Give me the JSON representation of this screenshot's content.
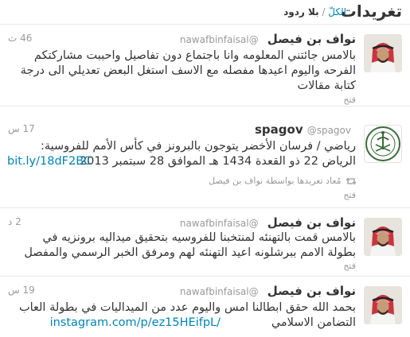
{
  "header": {
    "title": "تغريدات",
    "filter_all": "الكلّ",
    "filter_separator": "/",
    "filter_no_replies": "بلا ردود"
  },
  "tweets": [
    {
      "fullname": "نواف بن فيصل",
      "screenname": "@nawafbinfaisal",
      "time": "46 ث",
      "lines": [
        "بالامس جائتني المعلومه وانا باجتماع دون تفاصيل واحببت مشاركتكم",
        "الفرحه واليوم اعيدها مفصله مع الاسف استغل البعض تعديلي الى درجة",
        "كتابة مقالات"
      ],
      "action": "فتح"
    },
    {
      "fullname": "spagov",
      "screenname": "@spagov",
      "time": "17 س",
      "lines": [
        "رياضي / فرسان الأخضر يتوجون بالبرونز في كأس الأمم للفروسية:",
        "الرياض 22 ذو القعدة 1434 هـ الموافق 28 سبتمبر 2013..."
      ],
      "link": "bit.ly/18dF2BC",
      "retweeted_by": "مُعاد تغريدها بواسطة نواف بن فيصل",
      "action": "فتح"
    },
    {
      "fullname": "نواف بن فيصل",
      "screenname": "@nawafbinfaisal",
      "time": "2 د",
      "lines": [
        "بالامس قمت بالتهنئه لمنتخبنا للفروسيه بتحقيق ميداليه برونزيه في",
        "بطولة الامم ببرشلونه اعيد التهنئه لهم ومرفق الخبر الرسمي والمفصل"
      ],
      "action": "فتح"
    },
    {
      "fullname": "نواف بن فيصل",
      "screenname": "@nawafbinfaisal",
      "time": "19 س",
      "lines": [
        "بحمد الله حقق ابطالنا امس واليوم عدد من الميداليات في بطولة العاب",
        "التضامن الاسلامي"
      ],
      "link": "instagram.com/p/ez15HEifpL/"
    }
  ],
  "colors": {
    "link": "#0084b4",
    "muted": "#999999",
    "text": "#333333",
    "border": "#e8e8e8"
  }
}
